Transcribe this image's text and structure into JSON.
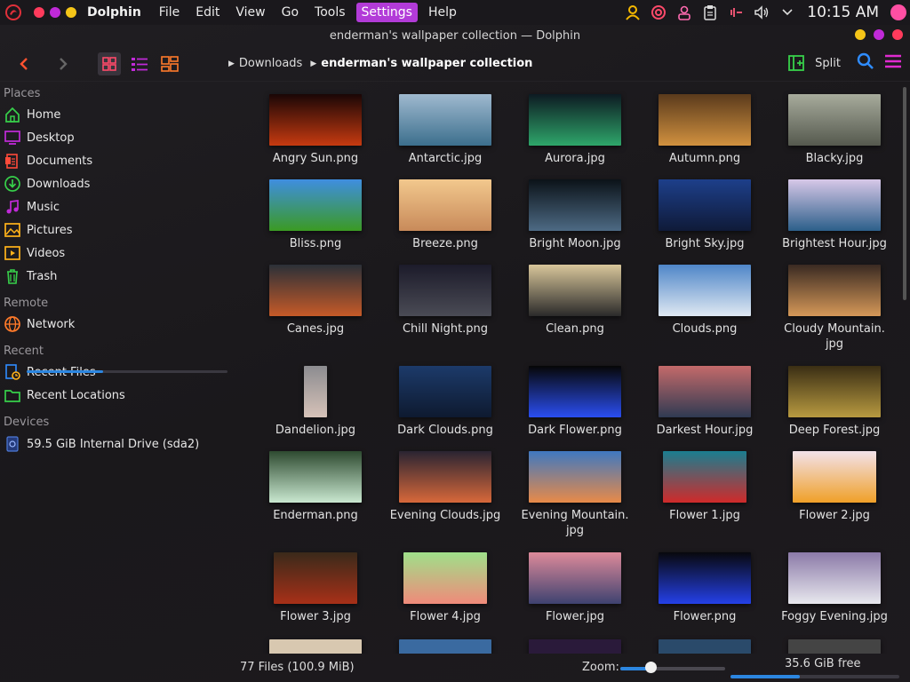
{
  "panel": {
    "app_name": "Dolphin",
    "menu": [
      "File",
      "Edit",
      "View",
      "Go",
      "Tools",
      "Settings",
      "Help"
    ],
    "active_menu_index": 5,
    "clock": "10:15 AM"
  },
  "window": {
    "title": "enderman's wallpaper collection — Dolphin"
  },
  "toolbar": {
    "breadcrumb": [
      "Downloads",
      "enderman's wallpaper collection"
    ],
    "split_label": "Split"
  },
  "sidebar": {
    "sections": {
      "places": "Places",
      "remote": "Remote",
      "recent": "Recent",
      "devices": "Devices"
    },
    "places": [
      "Home",
      "Desktop",
      "Documents",
      "Downloads",
      "Music",
      "Pictures",
      "Videos",
      "Trash"
    ],
    "remote": [
      "Network"
    ],
    "recent": [
      "Recent Files",
      "Recent Locations"
    ],
    "device": {
      "label": "59.5 GiB Internal Drive (sda2)",
      "usage": 0.38
    }
  },
  "files": [
    {
      "name": "Angry Sun.png"
    },
    {
      "name": "Antarctic.jpg"
    },
    {
      "name": "Aurora.jpg"
    },
    {
      "name": "Autumn.png"
    },
    {
      "name": "Blacky.jpg"
    },
    {
      "name": "Bliss.png"
    },
    {
      "name": "Breeze.png"
    },
    {
      "name": "Bright Moon.jpg"
    },
    {
      "name": "Bright Sky.jpg"
    },
    {
      "name": "Brightest Hour.jpg"
    },
    {
      "name": "Canes.jpg"
    },
    {
      "name": "Chill Night.png"
    },
    {
      "name": "Clean.png"
    },
    {
      "name": "Clouds.png"
    },
    {
      "name": "Cloudy Mountain.\njpg"
    },
    {
      "name": "Dandelion.jpg"
    },
    {
      "name": "Dark Clouds.png"
    },
    {
      "name": "Dark Flower.png"
    },
    {
      "name": "Darkest Hour.jpg"
    },
    {
      "name": "Deep Forest.jpg"
    },
    {
      "name": "Enderman.png"
    },
    {
      "name": "Evening Clouds.jpg"
    },
    {
      "name": "Evening Mountain.\njpg"
    },
    {
      "name": "Flower 1.jpg"
    },
    {
      "name": "Flower 2.jpg"
    },
    {
      "name": "Flower 3.jpg"
    },
    {
      "name": "Flower 4.jpg"
    },
    {
      "name": "Flower.jpg"
    },
    {
      "name": "Flower.png"
    },
    {
      "name": "Foggy Evening.jpg"
    }
  ],
  "thumb_colors": [
    [
      "#1a0606",
      "#c63a10"
    ],
    [
      "#9fb9cf",
      "#3c6f8d"
    ],
    [
      "#0d1a22",
      "#2ea66a"
    ],
    [
      "#5a3a1c",
      "#d1913f"
    ],
    [
      "#a7ab9c",
      "#55594e"
    ],
    [
      "#3f8ee0",
      "#3b9a23"
    ],
    [
      "#f2c88d",
      "#c88a5a"
    ],
    [
      "#0b1218",
      "#4d6a84"
    ],
    [
      "#1d3f8a",
      "#0f1a38"
    ],
    [
      "#d7c8e8",
      "#2c5f8a"
    ],
    [
      "#2b3038",
      "#c65a28"
    ],
    [
      "#1c1b2a",
      "#4a4b55"
    ],
    [
      "#d8c69a",
      "#2a2a2a"
    ],
    [
      "#4f86c8",
      "#dfe8f2"
    ],
    [
      "#3a2a22",
      "#d59858"
    ],
    [
      "#8c8c90",
      "#d6c2b8"
    ],
    [
      "#1c3a6a",
      "#0e1a30"
    ],
    [
      "#060606",
      "#2a4ef0"
    ],
    [
      "#c46a6a",
      "#2f3a52"
    ],
    [
      "#3a2e14",
      "#b89a40"
    ],
    [
      "#2e4a30",
      "#c9e8d0"
    ],
    [
      "#2a2432",
      "#d8683a"
    ],
    [
      "#3f78c0",
      "#e88a48"
    ],
    [
      "#1a7e90",
      "#d02a2a"
    ],
    [
      "#f2e2ea",
      "#f0a028"
    ],
    [
      "#3a2a1a",
      "#a83018"
    ],
    [
      "#9fe08a",
      "#f08a7a"
    ],
    [
      "#dd8a9a",
      "#3e4270"
    ],
    [
      "#08080c",
      "#2440e8"
    ],
    [
      "#8b7aa8",
      "#e8e8ee"
    ]
  ],
  "status": {
    "files": "77 Files (100.9 MiB)",
    "zoom_label": "Zoom:",
    "zoom_level": 0.3,
    "free_space": "35.6 GiB free",
    "free_fraction": 0.41
  }
}
